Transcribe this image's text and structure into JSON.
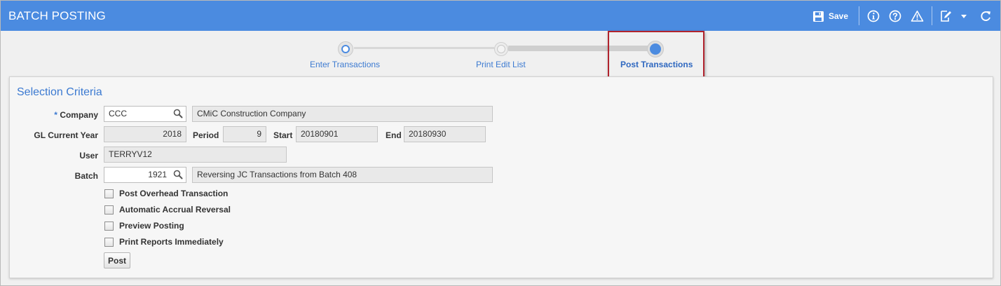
{
  "header": {
    "title": "BATCH POSTING",
    "save_label": "Save",
    "icons": [
      "save-icon",
      "info-icon",
      "help-icon",
      "warning-icon",
      "edit-icon",
      "chevron-down-icon",
      "refresh-icon"
    ]
  },
  "train": {
    "steps": [
      {
        "label": "Enter Transactions",
        "state": "visited"
      },
      {
        "label": "Print Edit List",
        "state": "visited"
      },
      {
        "label": "Post Transactions",
        "state": "current"
      }
    ]
  },
  "form": {
    "section_title": "Selection Criteria",
    "company": {
      "required_mark": "*",
      "label": "Company",
      "value": "CCC",
      "description": "CMiC Construction Company"
    },
    "gl_year": {
      "label": "GL Current Year",
      "value": "2018"
    },
    "period": {
      "label": "Period",
      "value": "9"
    },
    "start": {
      "label": "Start",
      "value": "20180901"
    },
    "end": {
      "label": "End",
      "value": "20180930"
    },
    "user": {
      "label": "User",
      "value": "TERRYV12"
    },
    "batch": {
      "label": "Batch",
      "value": "1921",
      "description": "Reversing JC Transactions from Batch 408"
    },
    "checkboxes": [
      {
        "label": "Post Overhead Transaction",
        "checked": false
      },
      {
        "label": "Automatic Accrual Reversal",
        "checked": false
      },
      {
        "label": "Preview Posting",
        "checked": false
      },
      {
        "label": "Print Reports Immediately",
        "checked": false
      }
    ],
    "post_button": "Post"
  },
  "colors": {
    "accent": "#4b8be0",
    "link": "#3c7ad1",
    "highlight": "#b0232d"
  }
}
